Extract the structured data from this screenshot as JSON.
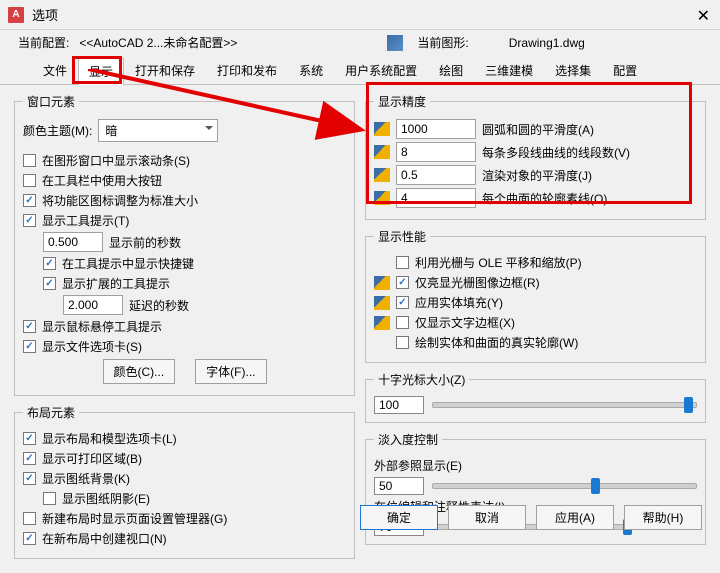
{
  "window": {
    "title": "选项",
    "close": "✕"
  },
  "info": {
    "cur_profile_lbl": "当前配置:",
    "cur_profile_val": "<<AutoCAD 2...未命名配置>>",
    "cur_dwg_lbl": "当前图形:",
    "cur_dwg_val": "Drawing1.dwg"
  },
  "tabs": [
    "文件",
    "显示",
    "打开和保存",
    "打印和发布",
    "系统",
    "用户系统配置",
    "绘图",
    "三维建模",
    "选择集",
    "配置"
  ],
  "left": {
    "g1_title": "窗口元素",
    "scheme_lbl": "颜色主题(M):",
    "scheme_val": "暗",
    "c_scroll": "在图形窗口中显示滚动条(S)",
    "c_bigbtn": "在工具栏中使用大按钮",
    "c_ribicon": "将功能区图标调整为标准大小",
    "c_tooltip": "显示工具提示(T)",
    "tip_delay": "0.500",
    "tip_delay_lbl": "显示前的秒数",
    "c_tipsc": "在工具提示中显示快捷键",
    "c_tipext": "显示扩展的工具提示",
    "tip_ext_delay": "2.000",
    "tip_ext_lbl": "延迟的秒数",
    "c_hover": "显示鼠标悬停工具提示",
    "c_filetab": "显示文件选项卡(S)",
    "btn_color": "颜色(C)...",
    "btn_font": "字体(F)...",
    "g2_title": "布局元素",
    "c_lay_tabs": "显示布局和模型选项卡(L)",
    "c_lay_print": "显示可打印区域(B)",
    "c_lay_paper": "显示图纸背景(K)",
    "c_lay_shadow": "显示图纸阴影(E)",
    "c_lay_pagesetup": "新建布局时显示页面设置管理器(G)",
    "c_lay_vp": "在新布局中创建视口(N)"
  },
  "right": {
    "g1_title": "显示精度",
    "p1_val": "1000",
    "p1_lbl": "圆弧和圆的平滑度(A)",
    "p2_val": "8",
    "p2_lbl": "每条多段线曲线的线段数(V)",
    "p3_val": "0.5",
    "p3_lbl": "渲染对象的平滑度(J)",
    "p4_val": "4",
    "p4_lbl": "每个曲面的轮廓素线(O)",
    "g2_title": "显示性能",
    "c_ole": "利用光栅与 OLE 平移和缩放(P)",
    "c_frame": "仅亮显光栅图像边框(R)",
    "c_solidfill": "应用实体填充(Y)",
    "c_textbound": "仅显示文字边框(X)",
    "c_silh": "绘制实体和曲面的真实轮廓(W)",
    "g3_title": "十字光标大小(Z)",
    "crosshair_val": "100",
    "g4_title": "淡入度控制",
    "xref_lbl": "外部参照显示(E)",
    "xref_val": "50",
    "inplace_lbl": "在位编辑和注释性表达(I)",
    "inplace_val": "70"
  },
  "footer": {
    "ok": "确定",
    "cancel": "取消",
    "apply": "应用(A)",
    "help": "帮助(H)"
  }
}
